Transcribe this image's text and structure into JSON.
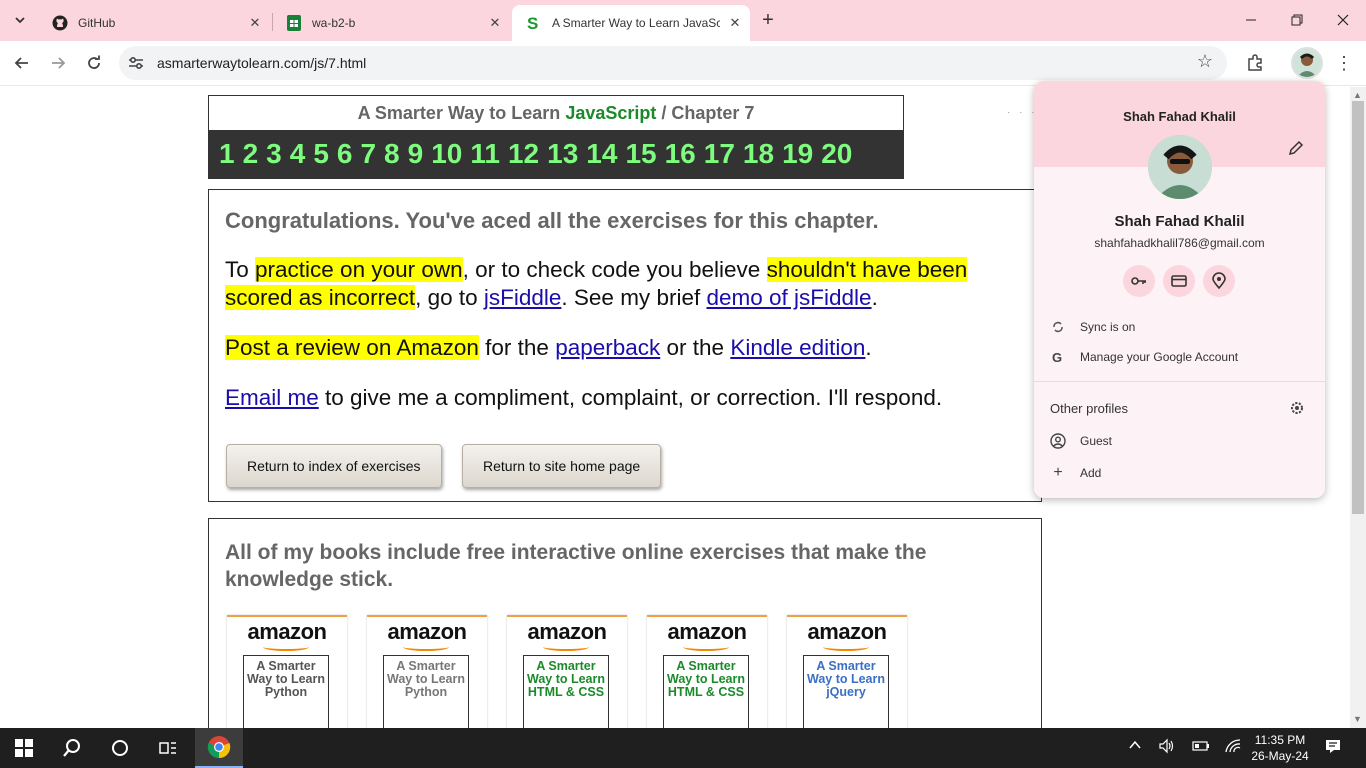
{
  "browser": {
    "tabs": [
      {
        "title": "GitHub",
        "icon": "github-icon"
      },
      {
        "title": "wa-b2-b",
        "icon": "sheets-icon"
      },
      {
        "title": "A Smarter Way to Learn JavaScript",
        "icon": "s-logo-icon",
        "active": true
      }
    ],
    "url": "asmarterwaytolearn.com/js/7.html"
  },
  "page": {
    "header": {
      "prefix": "A Smarter Way to Learn ",
      "brand": "JavaScript",
      "sep": " / ",
      "chapter": "Chapter 7"
    },
    "chapters": [
      "1",
      "2",
      "3",
      "4",
      "5",
      "6",
      "7",
      "8",
      "9",
      "10",
      "11",
      "12",
      "13",
      "14",
      "15",
      "16",
      "17",
      "18",
      "19",
      "20"
    ],
    "congrats": "Congratulations. You've aced all the exercises for this chapter.",
    "p1": {
      "t1": "To ",
      "h1": "practice on your own",
      "t2": ", or to check code you believe ",
      "h2": "shouldn't have been scored as incorrect",
      "t3": ", go to ",
      "l1": "jsFiddle",
      "t4": ". See my brief ",
      "l2": "demo of jsFiddle",
      "t5": "."
    },
    "p2": {
      "h1": "Post a review on Amazon",
      "t1": " for the ",
      "l1": "paperback",
      "t2": " or the ",
      "l2": "Kindle edition",
      "t3": "."
    },
    "p3": {
      "l1": "Email me",
      "t1": " to give me a compliment, complaint, or correction. I'll respond."
    },
    "buttons": {
      "index": "Return to index of exercises",
      "home": "Return to site home page"
    },
    "books_title": "All of my books include free interactive online exercises that make the knowledge stick.",
    "books": [
      {
        "brand": "amazon",
        "cover": "A Smarter Way to Learn Python",
        "color": "#555555"
      },
      {
        "brand": "amazon",
        "cover": "A Smarter Way to Learn Python",
        "color": "#777777"
      },
      {
        "brand": "amazon",
        "cover": "A Smarter Way to Learn HTML & CSS",
        "color": "#1a8a2a"
      },
      {
        "brand": "amazon",
        "cover": "A Smarter Way to Learn HTML & CSS",
        "color": "#1a8a2a"
      },
      {
        "brand": "amazon",
        "cover": "A Smarter Way to Learn jQuery",
        "color": "#3a6fc4"
      }
    ]
  },
  "profile": {
    "name_top": "Shah Fahad Khalil",
    "name": "Shah Fahad Khalil",
    "email": "shahfahadkhalil786@gmail.com",
    "sync": "Sync is on",
    "manage": "Manage your Google Account",
    "other_profiles": "Other profiles",
    "guest": "Guest",
    "add": "Add"
  },
  "taskbar": {
    "time": "11:35 PM",
    "date": "26-May-24"
  },
  "colors": {
    "accent_pink": "#fbd6de",
    "highlight": "#ffff00",
    "chapter_green": "#7dfc7d",
    "link": "#1a0dab"
  }
}
